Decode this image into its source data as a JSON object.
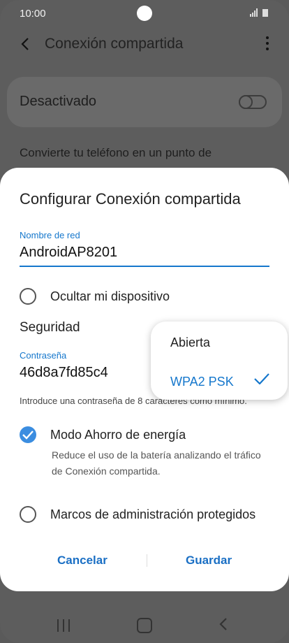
{
  "status": {
    "time": "10:00",
    "icons": "📶 ▮"
  },
  "appbar": {
    "title": "Conexión compartida"
  },
  "background": {
    "toggle_label": "Desactivado",
    "description": "Convierte tu teléfono en un punto de"
  },
  "dialog": {
    "title": "Configurar Conexión compartida",
    "network_name_label": "Nombre de red",
    "network_name_value": "AndroidAP8201",
    "hide_device_label": "Ocultar mi dispositivo",
    "security_label": "Seguridad",
    "password_label": "Contraseña",
    "password_value": "46d8a7fd85c4",
    "password_hint": "Introduce una contraseña de 8 caracteres como mínimo.",
    "power_saving_label": "Modo Ahorro de energía",
    "power_saving_desc": "Reduce el uso de la batería analizando el tráfico de Conexión compartida.",
    "pmf_label": "Marcos de administración protegidos",
    "cancel_label": "Cancelar",
    "save_label": "Guardar"
  },
  "security_dropdown": {
    "options": [
      "Abierta",
      "WPA2 PSK"
    ],
    "selected": "WPA2 PSK"
  },
  "colors": {
    "accent": "#1577cc",
    "checkbox": "#3b8de0"
  }
}
